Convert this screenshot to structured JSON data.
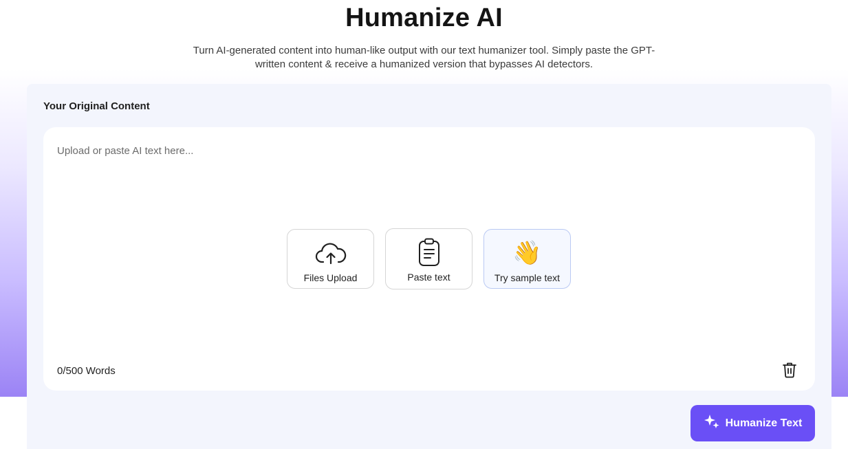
{
  "header": {
    "title": "Humanize AI",
    "subtitle_line1": "Turn AI-generated content into human-like output with our text humanizer tool. Simply paste the GPT-",
    "subtitle_line2": "written content & receive a humanized version that bypasses AI detectors."
  },
  "card": {
    "label": "Your Original Content",
    "placeholder": "Upload or paste AI text here...",
    "actions": [
      {
        "label": "Files Upload",
        "icon": "cloud-upload-icon"
      },
      {
        "label": "Paste text",
        "icon": "clipboard-icon"
      },
      {
        "label": "Try sample text",
        "icon": "waving-hand-icon",
        "glyph": "👋"
      }
    ],
    "word_count": "0/500 Words",
    "delete_icon": "trash-icon"
  },
  "cta": {
    "label": "Humanize Text",
    "icon": "sparkle-icon"
  },
  "colors": {
    "accent": "#6a4ff6",
    "card_bg": "#f3f5fd",
    "gradient_end": "#9b83f5"
  }
}
